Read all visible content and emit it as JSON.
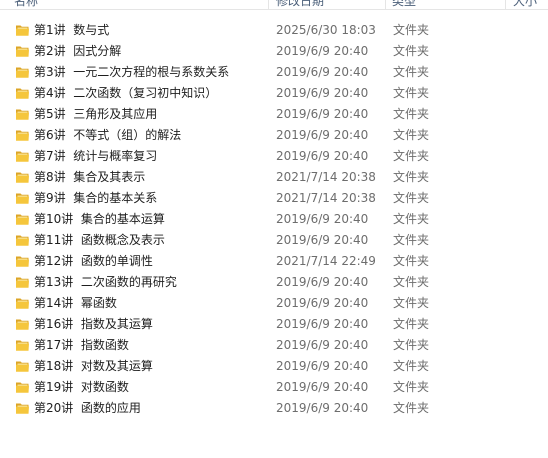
{
  "columns": {
    "name": "名称",
    "date": "修改日期",
    "type": "类型",
    "size": "大小"
  },
  "files": [
    {
      "name": "第1讲  数与式",
      "date": "2025/6/30 18:03",
      "type": "文件夹",
      "icon": "folder-icon"
    },
    {
      "name": "第2讲  因式分解",
      "date": "2019/6/9 20:40",
      "type": "文件夹",
      "icon": "folder-icon"
    },
    {
      "name": "第3讲  一元二次方程的根与系数关系",
      "date": "2019/6/9 20:40",
      "type": "文件夹",
      "icon": "folder-icon"
    },
    {
      "name": "第4讲  二次函数（复习初中知识）",
      "date": "2019/6/9 20:40",
      "type": "文件夹",
      "icon": "folder-icon"
    },
    {
      "name": "第5讲  三角形及其应用",
      "date": "2019/6/9 20:40",
      "type": "文件夹",
      "icon": "folder-icon"
    },
    {
      "name": "第6讲  不等式（组）的解法",
      "date": "2019/6/9 20:40",
      "type": "文件夹",
      "icon": "folder-icon"
    },
    {
      "name": "第7讲  统计与概率复习",
      "date": "2019/6/9 20:40",
      "type": "文件夹",
      "icon": "folder-icon"
    },
    {
      "name": "第8讲  集合及其表示",
      "date": "2021/7/14 20:38",
      "type": "文件夹",
      "icon": "folder-icon"
    },
    {
      "name": "第9讲  集合的基本关系",
      "date": "2021/7/14 20:38",
      "type": "文件夹",
      "icon": "folder-icon"
    },
    {
      "name": "第10讲  集合的基本运算",
      "date": "2019/6/9 20:40",
      "type": "文件夹",
      "icon": "folder-icon"
    },
    {
      "name": "第11讲  函数概念及表示",
      "date": "2019/6/9 20:40",
      "type": "文件夹",
      "icon": "folder-icon"
    },
    {
      "name": "第12讲  函数的单调性",
      "date": "2021/7/14 22:49",
      "type": "文件夹",
      "icon": "folder-icon"
    },
    {
      "name": "第13讲  二次函数的再研究",
      "date": "2019/6/9 20:40",
      "type": "文件夹",
      "icon": "folder-icon"
    },
    {
      "name": "第14讲  幂函数",
      "date": "2019/6/9 20:40",
      "type": "文件夹",
      "icon": "folder-icon"
    },
    {
      "name": "第16讲  指数及其运算",
      "date": "2019/6/9 20:40",
      "type": "文件夹",
      "icon": "folder-icon"
    },
    {
      "name": "第17讲  指数函数",
      "date": "2019/6/9 20:40",
      "type": "文件夹",
      "icon": "folder-icon"
    },
    {
      "name": "第18讲  对数及其运算",
      "date": "2019/6/9 20:40",
      "type": "文件夹",
      "icon": "folder-icon"
    },
    {
      "name": "第19讲  对数函数",
      "date": "2019/6/9 20:40",
      "type": "文件夹",
      "icon": "folder-icon"
    },
    {
      "name": "第20讲  函数的应用",
      "date": "2019/6/9 20:40",
      "type": "文件夹",
      "icon": "folder-icon"
    }
  ],
  "colors": {
    "folder_front": "#f5c63c",
    "folder_back": "#dca526",
    "folder_paper": "#fbe9a8",
    "header_text": "#4c607a",
    "secondary_text": "#6d6d6d"
  }
}
